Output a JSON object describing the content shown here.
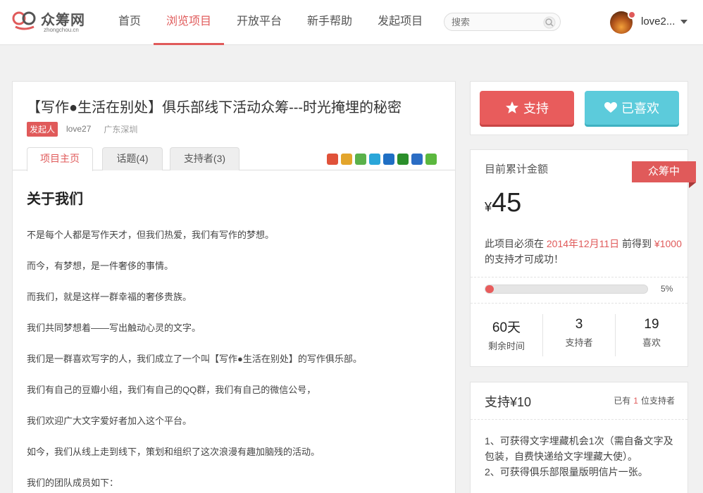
{
  "header": {
    "logo_text": "众筹网",
    "logo_sub": "zhongchou.cn",
    "nav": [
      {
        "label": "首页",
        "active": false
      },
      {
        "label": "浏览项目",
        "active": true
      },
      {
        "label": "开放平台",
        "active": false
      },
      {
        "label": "新手帮助",
        "active": false
      },
      {
        "label": "发起项目",
        "active": false
      }
    ],
    "search_placeholder": "搜索",
    "username": "love2..."
  },
  "project": {
    "title": "【写作●生活在别处】俱乐部线下活动众筹---时光掩埋的秘密",
    "initiator_badge": "发起人",
    "initiator": "love27",
    "location": "广东深圳",
    "tabs": [
      "项目主页",
      "话题(4)",
      "支持者(3)"
    ],
    "share_icons": [
      "weibo-icon",
      "renren-icon",
      "message-icon",
      "kaixin-icon",
      "qq-icon",
      "douban-icon",
      "person-icon",
      "plus-icon"
    ],
    "heading": "关于我们",
    "paragraphs": [
      "不是每个人都是写作天才，但我们热爱，我们有写作的梦想。",
      "而今，有梦想，是一件奢侈的事情。",
      "而我们，就是这样一群幸福的奢侈贵族。",
      "我们共同梦想着——写出触动心灵的文字。",
      "我们是一群喜欢写字的人，我们成立了一个叫【写作●生活在别处】的写作俱乐部。",
      "我们有自己的豆瓣小组，我们有自己的QQ群，我们有自己的微信公号，",
      "我们欢迎广大文字爱好者加入这个平台。",
      "如今，我们从线上走到线下，策划和组织了这次浪漫有趣加脑残的活动。",
      "我们的团队成员如下："
    ]
  },
  "actions": {
    "support": "支持",
    "liked": "已喜欢"
  },
  "stats": {
    "label": "目前累计金额",
    "status": "众筹中",
    "currency": "¥",
    "amount": "45",
    "note_pre": "此项目必须在",
    "note_date": "2014年12月11日",
    "note_mid": "前得到",
    "note_target": "¥1000",
    "note_post": "的支持才可成功！",
    "progress_percent": 5,
    "progress_label": "5%",
    "cells": [
      {
        "value": "60天",
        "key": "剩余时间"
      },
      {
        "value": "3",
        "key": "支持者"
      },
      {
        "value": "19",
        "key": "喜欢"
      }
    ]
  },
  "tier": {
    "title": "支持¥10",
    "count_pre": "已有",
    "count": "1",
    "count_post": "位支持者",
    "desc_1": "1、可获得文字埋藏机会1次（需自备文字及包装，自费快递给文字埋藏大使）。",
    "desc_2": "2、可获得俱乐部限量版明信片一张。"
  },
  "colors": {
    "accent": "#e05a5a",
    "like": "#5ccbdb"
  }
}
